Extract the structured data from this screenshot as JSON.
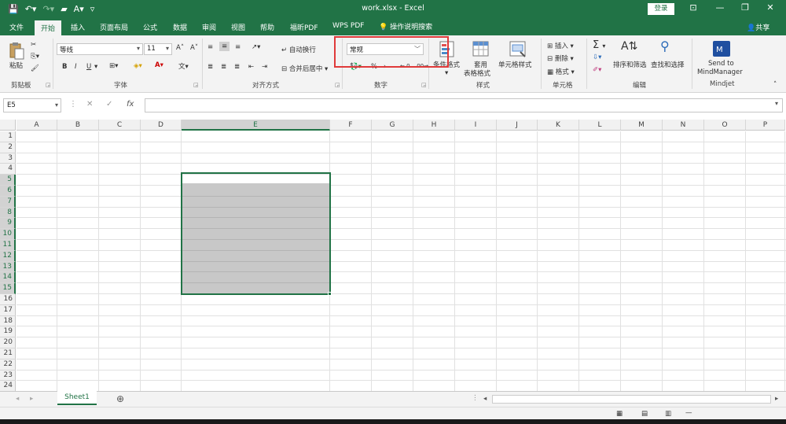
{
  "title_bar": {
    "title": "work.xlsx  -  Excel",
    "login": "登录"
  },
  "tabs": [
    "文件",
    "开始",
    "插入",
    "页面布局",
    "公式",
    "数据",
    "审阅",
    "视图",
    "帮助",
    "福昕PDF",
    "WPS PDF"
  ],
  "active_tab": "开始",
  "tell_me": "操作说明搜索",
  "share": "共享",
  "ribbon": {
    "clipboard": {
      "paste": "粘贴",
      "label": "剪贴板"
    },
    "font": {
      "name": "等线",
      "size": "11",
      "bold": "B",
      "italic": "I",
      "underline": "U",
      "label": "字体"
    },
    "alignment": {
      "wrap": "自动换行",
      "merge": "合并后居中",
      "label": "对齐方式"
    },
    "number": {
      "format": "常规",
      "percent": "%",
      "label": "数字"
    },
    "styles": {
      "conditional": "条件格式",
      "table_format": "套用\n表格格式",
      "table_format_1": "套用",
      "table_format_2": "表格格式",
      "cell_styles": "单元格样式",
      "label": "样式"
    },
    "cells": {
      "insert": "插入",
      "delete": "删除",
      "format": "格式",
      "label": "单元格"
    },
    "editing": {
      "sort_filter": "排序和筛选",
      "find_select": "查找和选择",
      "label": "编辑"
    },
    "mindjet": {
      "send_1": "Send to",
      "send_2": "MindManager",
      "label": "Mindjet"
    }
  },
  "formula_bar": {
    "name_box": "E5",
    "fx": "fx",
    "value": ""
  },
  "columns": [
    "A",
    "B",
    "C",
    "D",
    "E",
    "F",
    "G",
    "H",
    "I",
    "J",
    "K",
    "L",
    "M",
    "N",
    "O",
    "P"
  ],
  "selected_column": "E",
  "rows": [
    "1",
    "2",
    "3",
    "4",
    "5",
    "6",
    "7",
    "8",
    "9",
    "10",
    "11",
    "12",
    "13",
    "14",
    "15",
    "16",
    "17",
    "18",
    "19",
    "20",
    "21",
    "22",
    "23",
    "24"
  ],
  "selected_rows": [
    "5",
    "6",
    "7",
    "8",
    "9",
    "10",
    "11",
    "12",
    "13",
    "14",
    "15"
  ],
  "sheet_tabs": [
    "Sheet1"
  ],
  "colors": {
    "accent": "#217346",
    "highlight": "#e03a3a",
    "selection_fill": "#c8c8c8"
  }
}
